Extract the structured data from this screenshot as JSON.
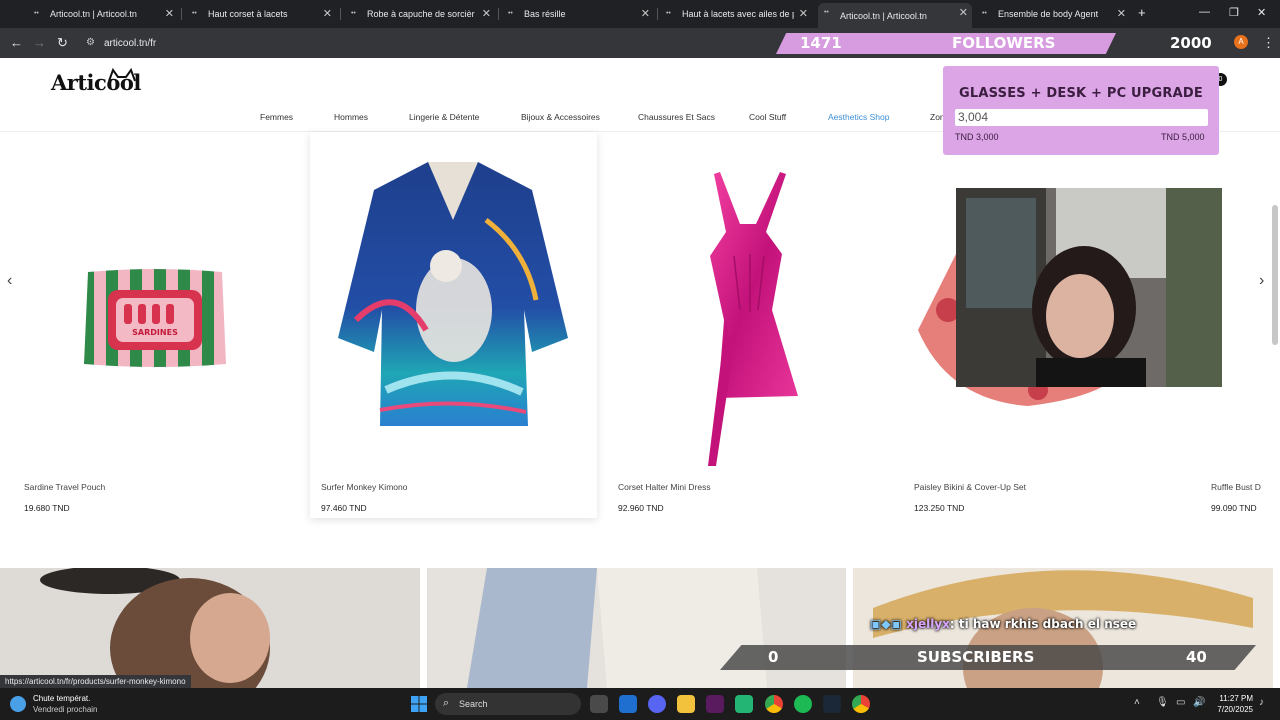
{
  "browser": {
    "tabs": [
      {
        "label": "Articool.tn | Articool.tn",
        "active": false
      },
      {
        "label": "Haut corset à lacets",
        "active": false
      },
      {
        "label": "Robe à capuche de sorcière no",
        "active": false
      },
      {
        "label": "Bas résille",
        "active": false
      },
      {
        "label": "Haut à lacets avec ailes de pap",
        "active": false
      },
      {
        "label": "Articool.tn | Articool.tn",
        "active": true
      },
      {
        "label": "Ensemble de body Agent",
        "active": false
      }
    ],
    "new_tab": "+",
    "url": "articool.tn/fr",
    "status_url": "https://articool.tn/fr/products/surfer-monkey-kimono"
  },
  "stream": {
    "followers": {
      "count": "1471",
      "label": "FOLLOWERS",
      "target": "2000"
    },
    "goal": {
      "title": "GLASSES + DESK + PC UPGRADE",
      "current": "3,004",
      "min_label": "TND 3,000",
      "max_label": "TND 5,000",
      "progress_fraction": 0.002
    },
    "chat": {
      "user": "xjellyx",
      "message": ": ti haw rkhis dbach el nsee"
    },
    "subscribers": {
      "count": "0",
      "label": "SUBSCRIBERS",
      "target": "40"
    }
  },
  "site": {
    "logo": "Articool",
    "cart_count": "0",
    "nav": [
      {
        "label": "Femmes"
      },
      {
        "label": "Hommes"
      },
      {
        "label": "Lingerie & Détente"
      },
      {
        "label": "Bijoux & Accessoires"
      },
      {
        "label": "Chaussures Et Sacs"
      },
      {
        "label": "Cool Stuff"
      },
      {
        "label": "Aesthetics Shop"
      },
      {
        "label": "Zon"
      }
    ],
    "products": [
      {
        "name": "Sardine Travel Pouch",
        "price": "19.680 TND"
      },
      {
        "name": "Surfer Monkey Kimono",
        "price": "97.460 TND"
      },
      {
        "name": "Corset Halter Mini Dress",
        "price": "92.960 TND"
      },
      {
        "name": "Paisley Bikini & Cover-Up Set",
        "price": "123.250 TND"
      },
      {
        "name": "Ruffle Bust D",
        "price": "99.090 TND"
      }
    ],
    "pouch_text": "SARDINES"
  },
  "taskbar": {
    "weather_title": "Chute températ.",
    "weather_sub": "Vendredi prochain",
    "search_placeholder": "Search",
    "time": "11:27 PM",
    "date": "7/20/2025"
  },
  "colors": {
    "accent_nav": "#3d8fd6",
    "goal_bg": "#dba5e6",
    "followers_bar": "#d79be0"
  }
}
